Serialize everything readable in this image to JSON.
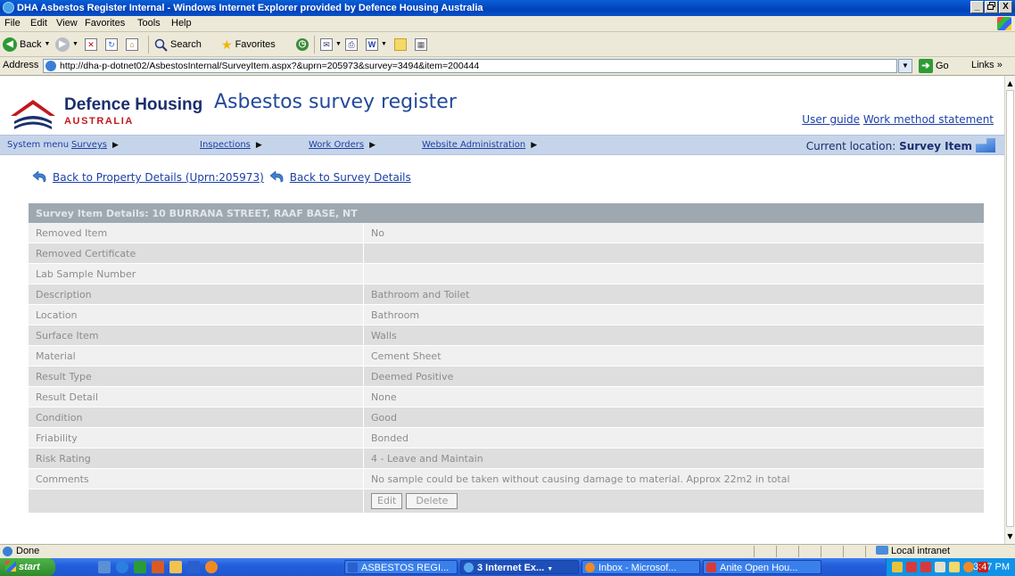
{
  "window": {
    "title": "DHA Asbestos Register Internal - Windows Internet Explorer provided by Defence Housing Australia",
    "buttons": [
      "_",
      " ",
      "X"
    ]
  },
  "menubar": {
    "items": [
      "File",
      "Edit",
      "View",
      "Favorites",
      "Tools",
      "Help"
    ]
  },
  "toolbar": {
    "back": "Back",
    "search": "Search",
    "favorites": "Favorites"
  },
  "addressbar": {
    "label": "Address",
    "url": "http://dha-p-dotnet02/AsbestosInternal/SurveyItem.aspx?&uprn=205973&survey=3494&item=200444",
    "go": "Go",
    "links": "Links"
  },
  "header": {
    "brand_name": "Defence Housing",
    "brand_sub": "AUSTRALIA",
    "app_title": "Asbestos survey register",
    "links": [
      "User guide",
      "Work method statement"
    ]
  },
  "nav": {
    "system_menu": "System menu",
    "items": [
      "Surveys",
      "Inspections",
      "Work Orders",
      "Website Administration"
    ],
    "location_label": "Current location:",
    "location_value": "Survey Item"
  },
  "back_links": {
    "property": "Back to Property Details (Uprn:205973)",
    "survey": "Back to Survey Details"
  },
  "details": {
    "heading": "Survey Item Details: 10 BURRANA STREET, RAAF BASE, NT",
    "rows": [
      {
        "label": "Removed Item",
        "value": "No"
      },
      {
        "label": "Removed Certificate",
        "value": ""
      },
      {
        "label": "Lab Sample Number",
        "value": ""
      },
      {
        "label": "Description",
        "value": "Bathroom and Toilet"
      },
      {
        "label": "Location",
        "value": "Bathroom"
      },
      {
        "label": "Surface Item",
        "value": "Walls"
      },
      {
        "label": "Material",
        "value": "Cement Sheet"
      },
      {
        "label": "Result Type",
        "value": "Deemed Positive"
      },
      {
        "label": "Result Detail",
        "value": "None"
      },
      {
        "label": "Condition",
        "value": "Good"
      },
      {
        "label": "Friability",
        "value": "Bonded"
      },
      {
        "label": "Risk Rating",
        "value": "4 - Leave and Maintain"
      },
      {
        "label": "Comments",
        "value": "No sample could be taken without causing damage to material. Approx 22m2 in total"
      }
    ],
    "edit_label": "Edit",
    "delete_label": "Delete"
  },
  "statusbar": {
    "text": "Done",
    "zone": "Local intranet"
  },
  "taskbar": {
    "start": "start",
    "tasks": [
      "ASBESTOS REGI...",
      "3 Internet Ex...",
      "Inbox - Microsof...",
      "Anite Open Hou..."
    ],
    "clock": "3:47 PM"
  }
}
